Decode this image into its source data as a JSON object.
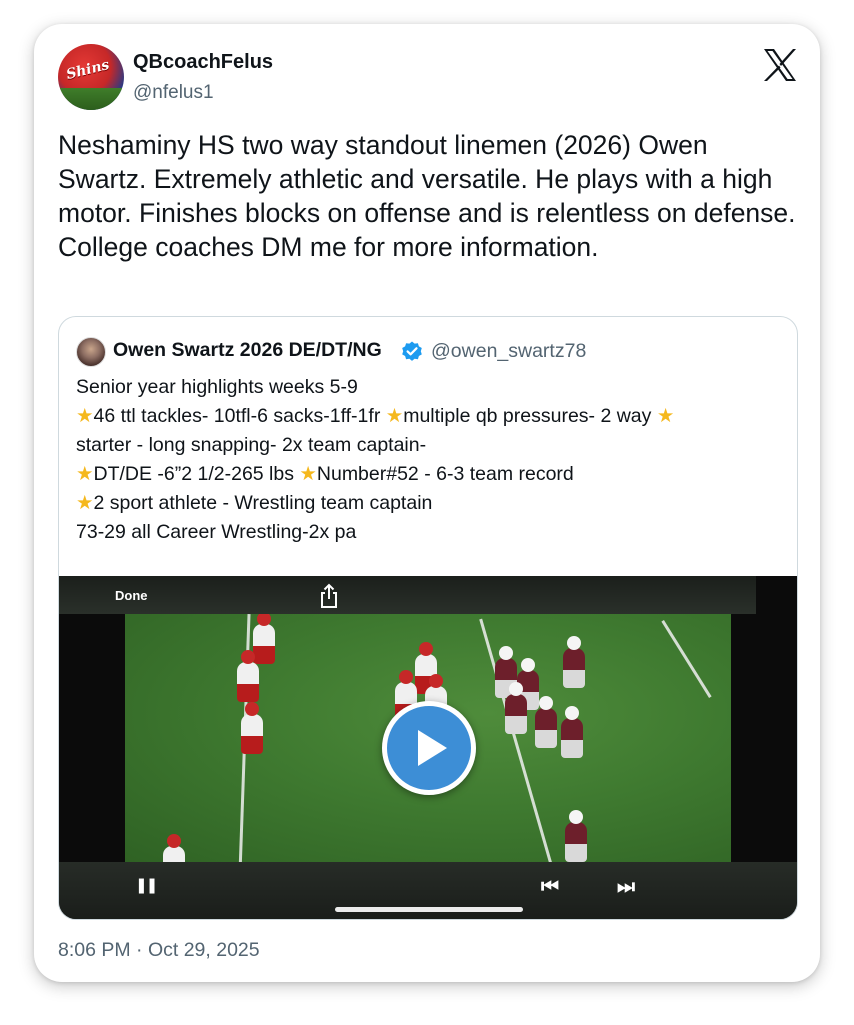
{
  "author": {
    "display_name": "QBcoachFelus",
    "handle": "@nfelus1",
    "avatar_logo_text": "Shins"
  },
  "tweet": {
    "text": "Neshaminy HS two way standout linemen (2026) Owen Swartz. Extremely athletic and versatile. He plays with a high motor. Finishes blocks on offense and is relentless on defense. College coaches DM me for more information.",
    "timestamp": "8:06 PM · Oct 29, 2025"
  },
  "quoted": {
    "display_name": "Owen Swartz 2026 DE/DT/NG",
    "handle": "@owen_swartz78",
    "lines": {
      "l1": "Senior year highlights weeks 5-9",
      "l2a": "46 ttl tackles- 10tfl-6 sacks-1ff-1fr ",
      "l2b": "multiple qb pressures- 2 way ",
      "l3": "starter - long snapping- 2x team captain-",
      "l4a": "DT/DE -6”2 1/2-265 lbs ",
      "l4b": "Number#52 - 6-3 team record",
      "l5": "2 sport athlete - Wrestling team captain",
      "l6": "73-29 all Career Wrestling-2x pa"
    },
    "star_glyph": "★"
  },
  "video": {
    "done_label": "Done",
    "pause_glyph": "❚❚",
    "prev_glyph": "⏮",
    "next_glyph": "⏭"
  },
  "colors": {
    "accent_blue": "#1d9bf0",
    "play_button": "#3d8ed6",
    "star": "#f5b81d",
    "secondary_text": "#536471"
  },
  "icons": [
    "x-logo-icon",
    "verified-badge-icon",
    "share-icon",
    "play-icon",
    "pause-icon",
    "skip-back-icon",
    "skip-forward-icon"
  ]
}
